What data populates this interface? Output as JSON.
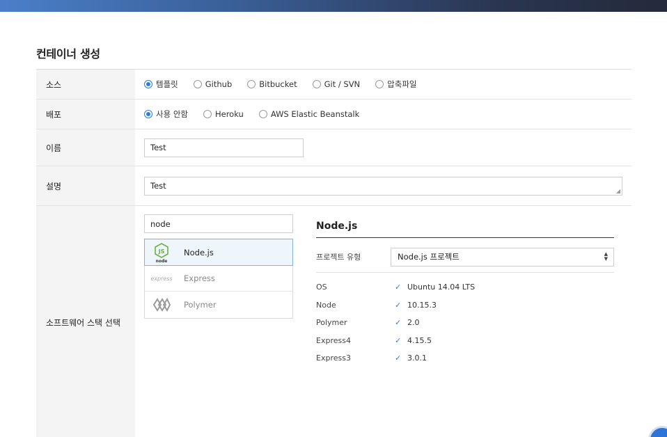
{
  "page": {
    "title": "컨테이너 생성"
  },
  "form": {
    "source": {
      "label": "소스",
      "options": [
        {
          "label": "템플릿",
          "selected": true
        },
        {
          "label": "Github",
          "selected": false
        },
        {
          "label": "Bitbucket",
          "selected": false
        },
        {
          "label": "Git / SVN",
          "selected": false
        },
        {
          "label": "압축파일",
          "selected": false
        }
      ]
    },
    "deploy": {
      "label": "배포",
      "options": [
        {
          "label": "사용 안함",
          "selected": true
        },
        {
          "label": "Heroku",
          "selected": false
        },
        {
          "label": "AWS Elastic Beanstalk",
          "selected": false
        }
      ]
    },
    "name": {
      "label": "이름",
      "value": "Test"
    },
    "description": {
      "label": "설명",
      "value": "Test"
    },
    "stack": {
      "label": "소프트웨어 스택 선택",
      "search_value": "node",
      "items": [
        {
          "name": "Node.js",
          "icon": "nodejs-logo-icon",
          "selected": true,
          "logo_text": "node"
        },
        {
          "name": "Express",
          "icon": "express-logo-icon",
          "selected": false,
          "logo_text": "express"
        },
        {
          "name": "Polymer",
          "icon": "polymer-logo-icon",
          "selected": false,
          "logo_text": ""
        }
      ]
    }
  },
  "detail": {
    "title": "Node.js",
    "project_type_label": "프로젝트 유형",
    "project_type_value": "Node.js 프로젝트",
    "versions": [
      {
        "name": "OS",
        "value": "Ubuntu 14.04 LTS"
      },
      {
        "name": "Node",
        "value": "10.15.3"
      },
      {
        "name": "Polymer",
        "value": "2.0"
      },
      {
        "name": "Express4",
        "value": "4.15.5"
      },
      {
        "name": "Express3",
        "value": "3.0.1"
      }
    ]
  },
  "colors": {
    "accent": "#2b7be0",
    "label_bg": "#f4f4f4",
    "selected_bg": "#eef6fb"
  }
}
